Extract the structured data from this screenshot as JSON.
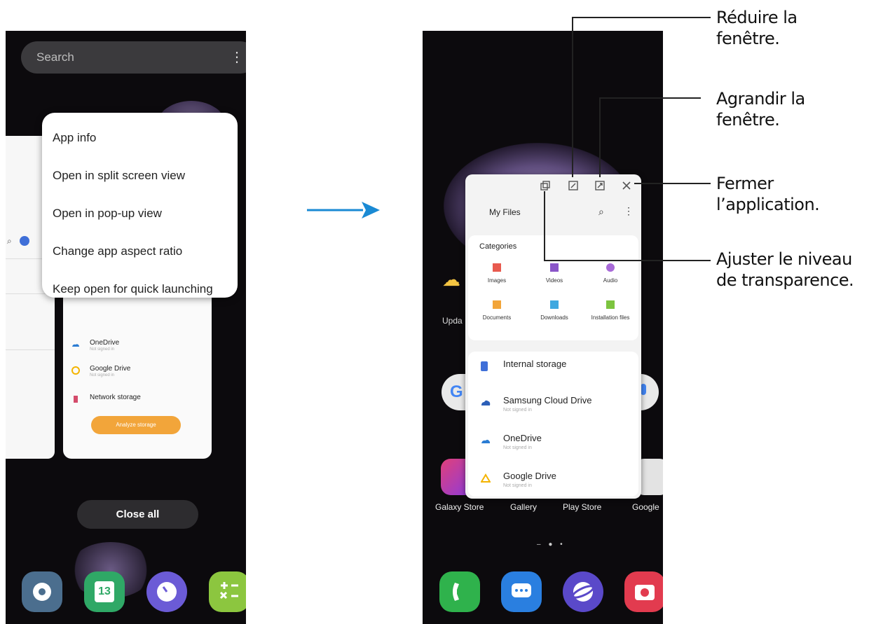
{
  "left_screen": {
    "search_placeholder": "Search",
    "menu_icon": "more-vert-icon",
    "context_menu": [
      "App info",
      "Open in split screen view",
      "Open in pop-up view",
      "Change app aspect ratio",
      "Keep open for quick launching"
    ],
    "recent_card_rows": [
      {
        "label": "OneDrive",
        "sub": "Not signed in"
      },
      {
        "label": "Google Drive",
        "sub": "Not signed in"
      },
      {
        "label": "Network storage",
        "sub": ""
      }
    ],
    "analyze_button": "Analyze storage",
    "close_all": "Close all",
    "dock_icons": [
      "settings-icon",
      "calendar-icon",
      "clock-icon",
      "calculator-icon"
    ],
    "calendar_day": "13"
  },
  "right_screen": {
    "popup": {
      "title": "My Files",
      "categories_title": "Categories",
      "categories": [
        "Images",
        "Videos",
        "Audio",
        "Documents",
        "Downloads",
        "Installation files"
      ],
      "storage_items": [
        {
          "label": "Internal storage",
          "sub": ""
        },
        {
          "label": "Samsung Cloud Drive",
          "sub": "Not signed in"
        },
        {
          "label": "OneDrive",
          "sub": "Not signed in"
        },
        {
          "label": "Google Drive",
          "sub": "Not signed in"
        }
      ]
    },
    "weather_label": "Upda",
    "home_apps": [
      "Galaxy Store",
      "Gallery",
      "Play Store",
      "Google"
    ],
    "dock_icons": [
      "phone-icon",
      "messages-icon",
      "internet-icon",
      "camera-icon"
    ]
  },
  "callouts": {
    "minimize": "Réduire la fenêtre.",
    "maximize": "Agrandir la fenêtre.",
    "close": "Fermer l’application.",
    "transparency": "Ajuster le niveau de transparence."
  },
  "callout_lines": {
    "minimize": [
      "Réduire la",
      "fenêtre."
    ],
    "maximize": [
      "Agrandir la",
      "fenêtre."
    ],
    "close": [
      "Fermer",
      "l’application."
    ],
    "transparency": [
      "Ajuster le niveau",
      "de transparence."
    ]
  },
  "colors": {
    "arrow": "#1a8ad4",
    "accent_orange": "#f2a53a",
    "phone_bg": "#0c0a0d"
  }
}
